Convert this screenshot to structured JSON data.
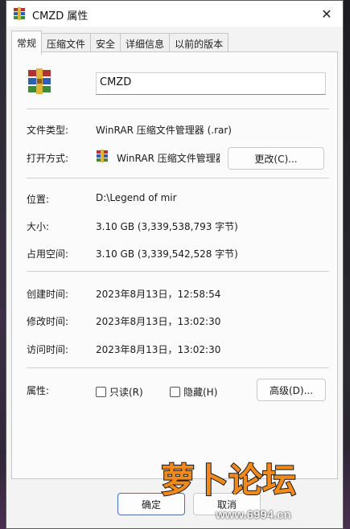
{
  "window": {
    "title": "CMZD 属性",
    "close_icon": "✕"
  },
  "tabs": [
    {
      "label": "常规",
      "active": true
    },
    {
      "label": "压缩文件",
      "active": false
    },
    {
      "label": "安全",
      "active": false
    },
    {
      "label": "详细信息",
      "active": false
    },
    {
      "label": "以前的版本",
      "active": false
    }
  ],
  "general": {
    "file_name": "CMZD",
    "type_label": "文件类型:",
    "type_value": "WinRAR 压缩文件管理器 (.rar)",
    "open_with_label": "打开方式:",
    "open_with_value": "WinRAR 压缩文件管理器",
    "change_button": "更改(C)...",
    "location_label": "位置:",
    "location_value": "D:\\Legend of mir",
    "size_label": "大小:",
    "size_value": "3.10 GB (3,339,538,793 字节)",
    "disk_size_label": "占用空间:",
    "disk_size_value": "3.10 GB (3,339,542,528 字节)",
    "created_label": "创建时间:",
    "created_value": "2023年8月13日，12:58:54",
    "modified_label": "修改时间:",
    "modified_value": "2023年8月13日，13:02:30",
    "accessed_label": "访问时间:",
    "accessed_value": "2023年8月13日，13:02:30",
    "attributes_label": "属性:",
    "readonly_label": "只读(R)",
    "hidden_label": "隐藏(H)",
    "advanced_button": "高级(D)..."
  },
  "footer": {
    "ok_button": "确定",
    "cancel_button": "取消"
  },
  "watermark": {
    "text": "萝卜论坛",
    "url": "www.6994.cn"
  },
  "colors": {
    "winrar_red": "#b5332e",
    "winrar_blue": "#2f5fb4",
    "winrar_green": "#3c8a3a",
    "winrar_yellow": "#e0b33a",
    "watermark_orange": "#f08a1c"
  }
}
